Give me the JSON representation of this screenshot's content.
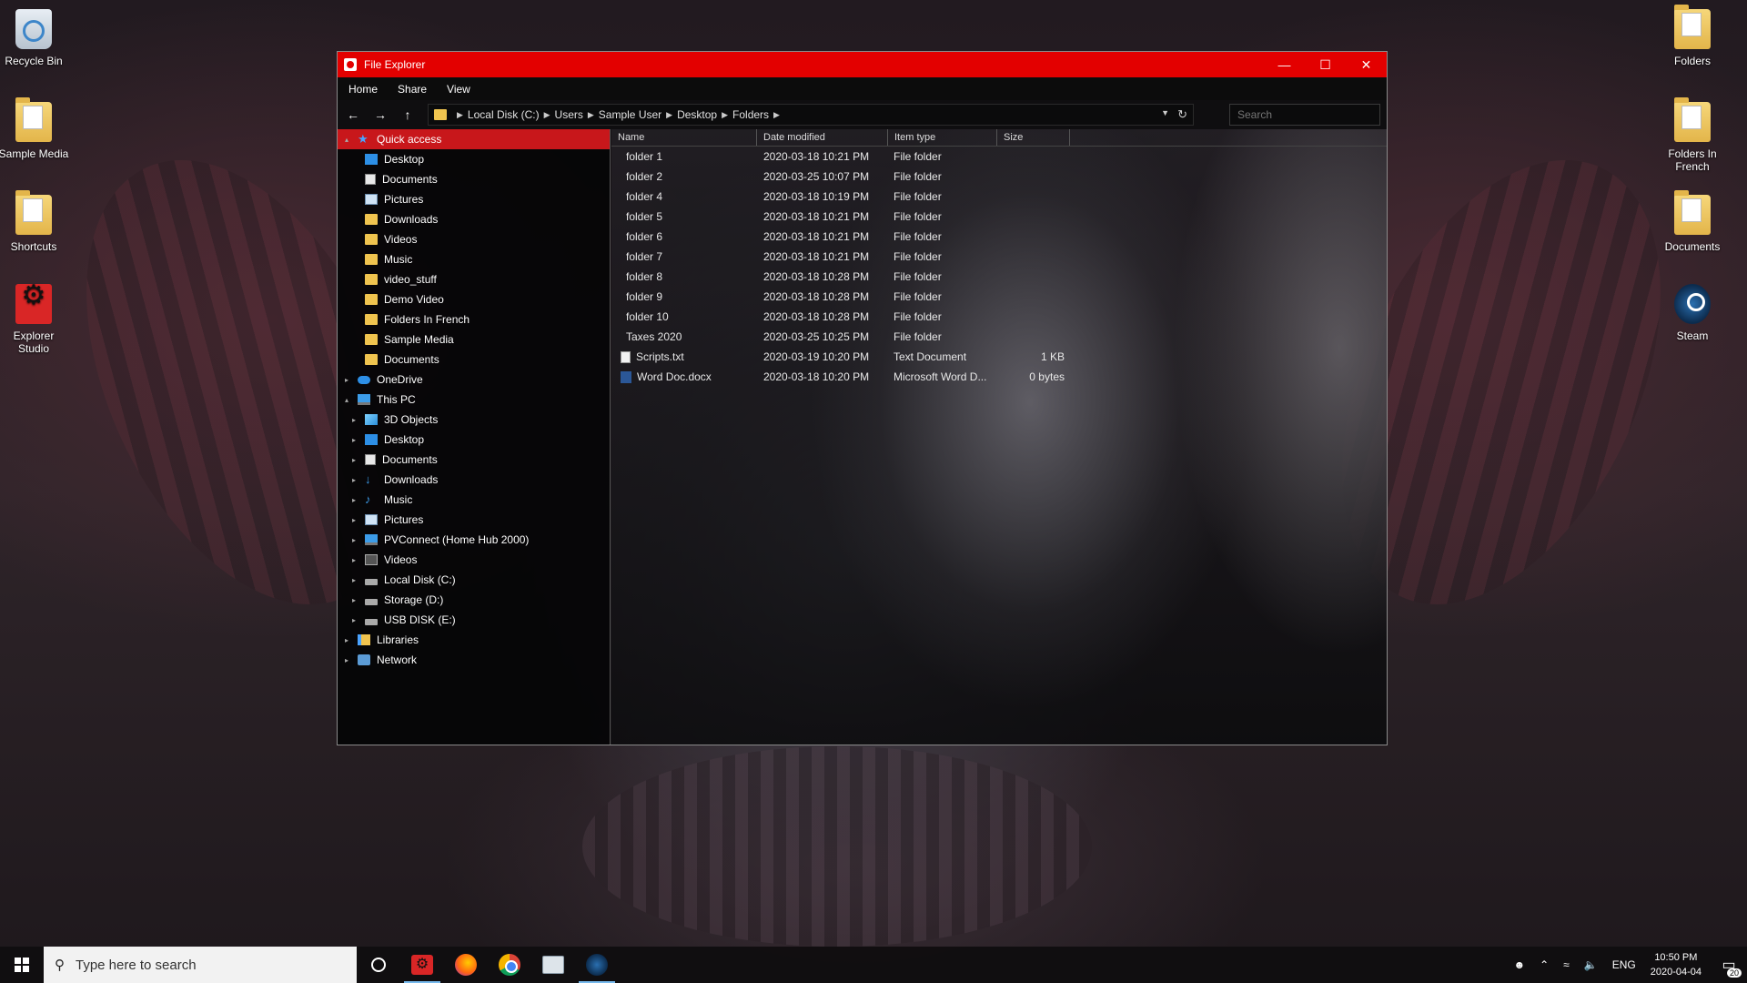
{
  "desktop": {
    "left_icons": [
      {
        "label": "Recycle Bin"
      },
      {
        "label": "Sample Media"
      },
      {
        "label": "Shortcuts"
      },
      {
        "label": "Explorer Studio"
      }
    ],
    "right_icons": [
      {
        "label": "Folders"
      },
      {
        "label": "Folders In French"
      },
      {
        "label": "Documents"
      },
      {
        "label": "Steam"
      }
    ]
  },
  "window": {
    "title": "File Explorer",
    "menu": [
      "Home",
      "Share",
      "View"
    ],
    "address": {
      "crumbs": [
        "Local Disk (C:)",
        "Users",
        "Sample User",
        "Desktop",
        "Folders"
      ]
    },
    "search_placeholder": "Search",
    "nav": [
      {
        "label": "Quick access",
        "icon": "star-icon"
      },
      {
        "label": "Desktop",
        "icon": "desktop-icon"
      },
      {
        "label": "Documents",
        "icon": "documents-icon"
      },
      {
        "label": "Pictures",
        "icon": "pictures-icon"
      },
      {
        "label": "Downloads",
        "icon": "folder-icon"
      },
      {
        "label": "Videos",
        "icon": "folder-icon"
      },
      {
        "label": "Music",
        "icon": "folder-icon"
      },
      {
        "label": "video_stuff",
        "icon": "folder-icon"
      },
      {
        "label": "Demo Video",
        "icon": "folder-icon"
      },
      {
        "label": "Folders In French",
        "icon": "folder-icon"
      },
      {
        "label": "Sample Media",
        "icon": "folder-icon"
      },
      {
        "label": "Documents",
        "icon": "folder-icon"
      },
      {
        "label": "OneDrive",
        "icon": "cloud-icon"
      },
      {
        "label": "This PC",
        "icon": "pc-icon"
      },
      {
        "label": "3D Objects",
        "icon": "cube-icon"
      },
      {
        "label": "Desktop",
        "icon": "desktop-icon"
      },
      {
        "label": "Documents",
        "icon": "documents-icon"
      },
      {
        "label": "Downloads",
        "icon": "download-icon"
      },
      {
        "label": "Music",
        "icon": "music-icon"
      },
      {
        "label": "Pictures",
        "icon": "pictures-icon"
      },
      {
        "label": "PVConnect (Home Hub 2000)",
        "icon": "network-device-icon"
      },
      {
        "label": "Videos",
        "icon": "videos-icon"
      },
      {
        "label": "Local Disk (C:)",
        "icon": "drive-icon"
      },
      {
        "label": "Storage (D:)",
        "icon": "drive-icon"
      },
      {
        "label": "USB DISK (E:)",
        "icon": "drive-icon"
      },
      {
        "label": "Libraries",
        "icon": "libraries-icon"
      },
      {
        "label": "Network",
        "icon": "network-icon"
      }
    ],
    "columns": {
      "name": "Name",
      "date": "Date modified",
      "type": "Item type",
      "size": "Size"
    },
    "files": [
      {
        "name": "folder 1",
        "date": "2020-03-18 10:21 PM",
        "type": "File folder",
        "size": ""
      },
      {
        "name": "folder 2",
        "date": "2020-03-25 10:07 PM",
        "type": "File folder",
        "size": ""
      },
      {
        "name": "folder 4",
        "date": "2020-03-18 10:19 PM",
        "type": "File folder",
        "size": ""
      },
      {
        "name": "folder 5",
        "date": "2020-03-18 10:21 PM",
        "type": "File folder",
        "size": ""
      },
      {
        "name": "folder 6",
        "date": "2020-03-18 10:21 PM",
        "type": "File folder",
        "size": ""
      },
      {
        "name": "folder 7",
        "date": "2020-03-18 10:21 PM",
        "type": "File folder",
        "size": ""
      },
      {
        "name": "folder 8",
        "date": "2020-03-18 10:28 PM",
        "type": "File folder",
        "size": ""
      },
      {
        "name": "folder 9",
        "date": "2020-03-18 10:28 PM",
        "type": "File folder",
        "size": ""
      },
      {
        "name": "folder 10",
        "date": "2020-03-18 10:28 PM",
        "type": "File folder",
        "size": ""
      },
      {
        "name": "Taxes 2020",
        "date": "2020-03-25 10:25 PM",
        "type": "File folder",
        "size": ""
      },
      {
        "name": "Scripts.txt",
        "date": "2020-03-19 10:20 PM",
        "type": "Text Document",
        "size": "1 KB"
      },
      {
        "name": "Word Doc.docx",
        "date": "2020-03-18 10:20 PM",
        "type": "Microsoft Word D...",
        "size": "0 bytes"
      }
    ]
  },
  "taskbar": {
    "search_placeholder": "Type here to search",
    "tray": {
      "language": "ENG",
      "time": "10:50 PM",
      "date": "2020-04-04",
      "notification_count": "20"
    }
  },
  "colors": {
    "accent": "#e30000",
    "selection": "#c8171b",
    "folder": "#f0c44f"
  }
}
